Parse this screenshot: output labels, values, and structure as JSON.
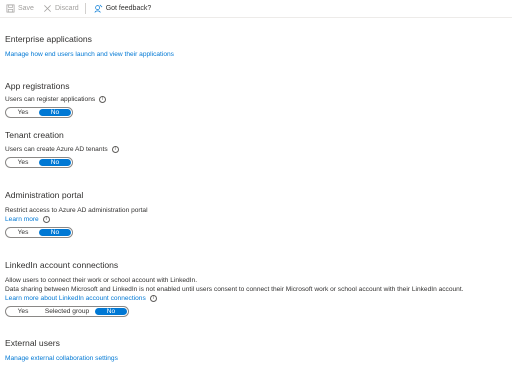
{
  "toolbar": {
    "save_label": "Save",
    "discard_label": "Discard",
    "feedback_label": "Got feedback?"
  },
  "enterprise": {
    "title": "Enterprise applications",
    "link": "Manage how end users launch and view their applications"
  },
  "app_registrations": {
    "title": "App registrations",
    "label": "Users can register applications",
    "options": [
      "Yes",
      "No"
    ],
    "selected": "No"
  },
  "tenant": {
    "title": "Tenant creation",
    "label": "Users can create Azure AD tenants",
    "options": [
      "Yes",
      "No"
    ],
    "selected": "No"
  },
  "admin_portal": {
    "title": "Administration portal",
    "label": "Restrict access to Azure AD administration portal",
    "learn_more": "Learn more",
    "options": [
      "Yes",
      "No"
    ],
    "selected": "No"
  },
  "linkedin": {
    "title": "LinkedIn account connections",
    "line1": "Allow users to connect their work or school account with LinkedIn.",
    "line2": "Data sharing between Microsoft and LinkedIn is not enabled until users consent to connect their Microsoft work or school account with their LinkedIn account.",
    "learn_more": "Learn more about LinkedIn account connections",
    "options": [
      "Yes",
      "Selected group",
      "No"
    ],
    "selected": "No"
  },
  "external": {
    "title": "External users",
    "link": "Manage external collaboration settings"
  }
}
